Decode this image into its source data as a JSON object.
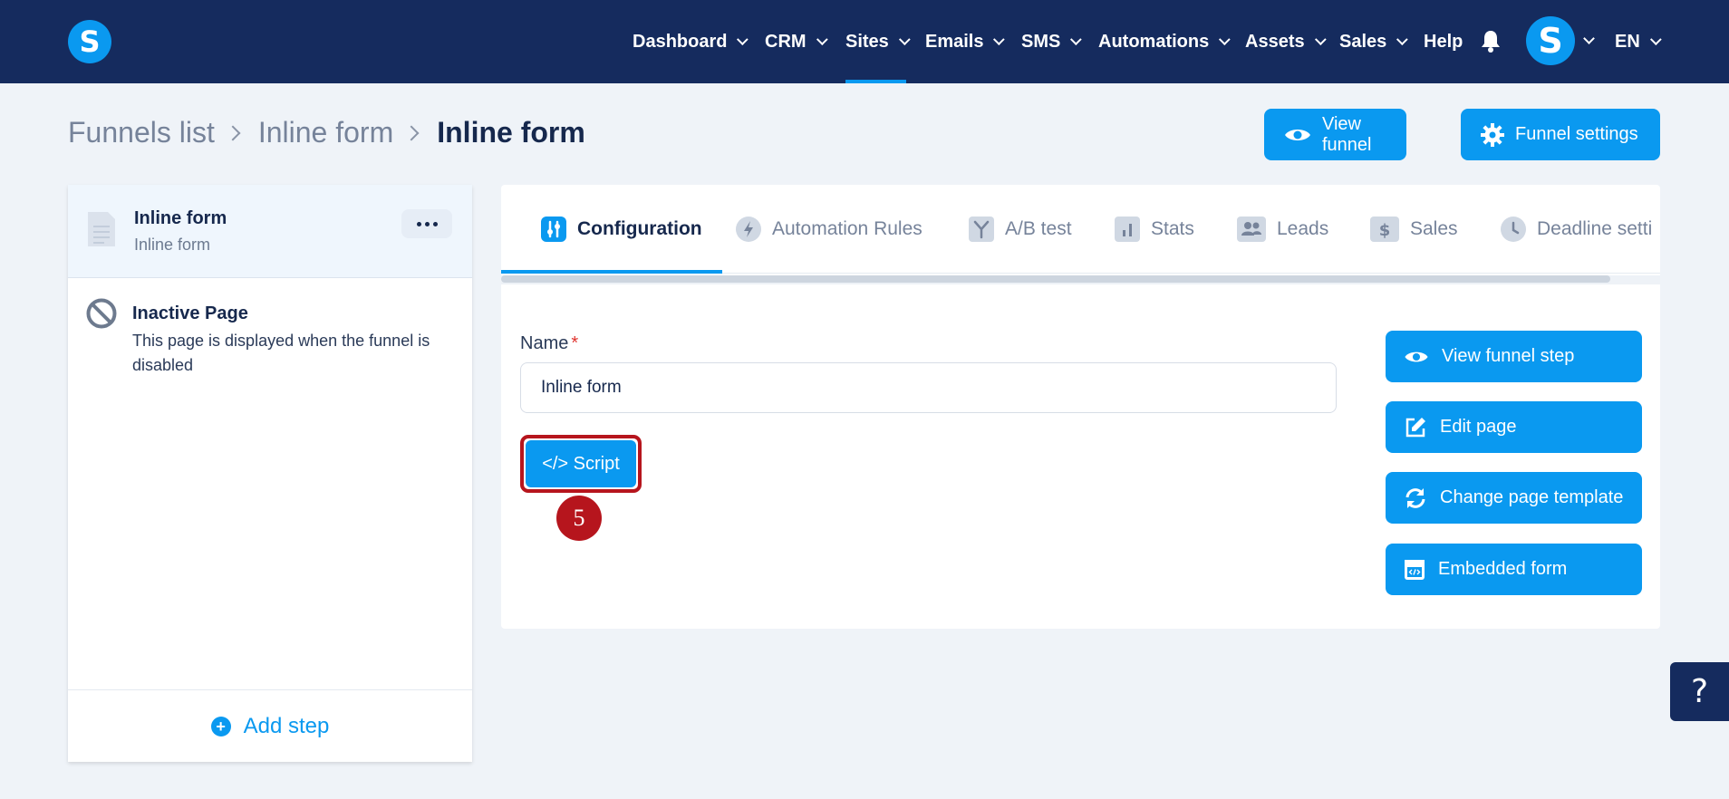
{
  "nav": {
    "items": [
      {
        "label": "Dashboard",
        "chevron": true
      },
      {
        "label": "CRM",
        "chevron": true
      },
      {
        "label": "Sites",
        "chevron": true,
        "active": true
      },
      {
        "label": "Emails",
        "chevron": true
      },
      {
        "label": "SMS",
        "chevron": true
      },
      {
        "label": "Automations",
        "chevron": true
      },
      {
        "label": "Assets",
        "chevron": true
      },
      {
        "label": "Sales",
        "chevron": true
      },
      {
        "label": "Help",
        "chevron": false
      }
    ],
    "logo_letter": "S",
    "avatar_letter": "S",
    "language": "EN"
  },
  "breadcrumb": [
    "Funnels list",
    "Inline form",
    "Inline form"
  ],
  "header_buttons": {
    "view_funnel": "View funnel",
    "funnel_settings": "Funnel settings"
  },
  "sidebar": {
    "active_step": {
      "title": "Inline form",
      "subtitle": "Inline form"
    },
    "inactive_page": {
      "title": "Inactive Page",
      "description": "This page is displayed when the funnel is disabled"
    },
    "add_step": "Add step"
  },
  "tabs": [
    {
      "label": "Configuration",
      "icon": "sliders-icon",
      "active": true
    },
    {
      "label": "Automation Rules",
      "icon": "bolt-icon"
    },
    {
      "label": "A/B test",
      "icon": "split-icon"
    },
    {
      "label": "Stats",
      "icon": "bar-chart-icon"
    },
    {
      "label": "Leads",
      "icon": "users-icon"
    },
    {
      "label": "Sales",
      "icon": "dollar-icon"
    },
    {
      "label": "Deadline setti",
      "icon": "clock-icon"
    }
  ],
  "form": {
    "name_label": "Name",
    "required_mark": "*",
    "name_value": "Inline form",
    "script_button": "</> Script"
  },
  "step_badge": "5",
  "actions": {
    "view_funnel_step": "View funnel step",
    "edit_page": "Edit page",
    "change_page_template": "Change page template",
    "embedded_form": "Embedded form"
  },
  "help": "?",
  "colors": {
    "navbar": "#152b5e",
    "accent": "#0a99f0",
    "highlight": "#b6151d",
    "background": "#eff3f8"
  }
}
